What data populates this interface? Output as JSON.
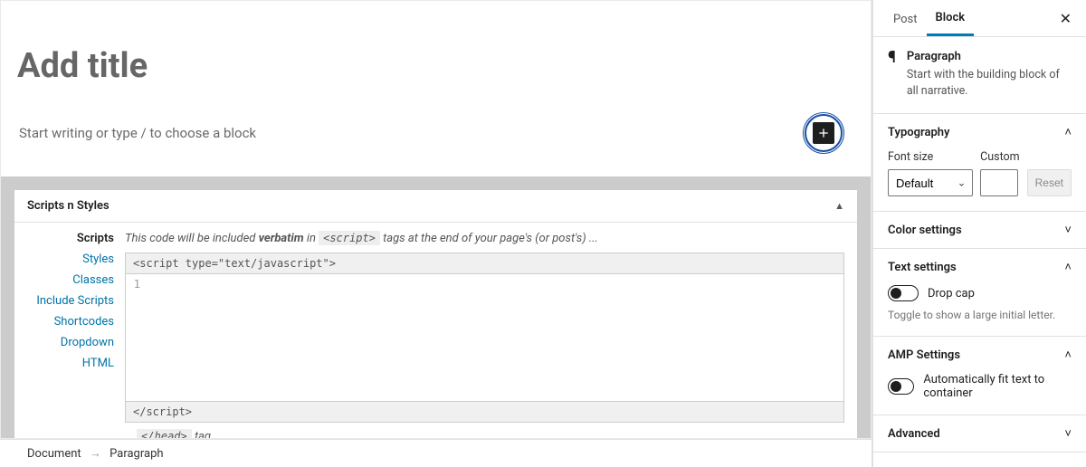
{
  "editor": {
    "title_placeholder": "Add title",
    "paragraph_placeholder": "Start writing or type / to choose a block"
  },
  "metabox": {
    "title": "Scripts n Styles",
    "nav": {
      "scripts": "Scripts",
      "styles": "Styles",
      "classes": "Classes",
      "include_scripts": "Include Scripts",
      "shortcodes": "Shortcodes",
      "dropdown": "Dropdown",
      "html": "HTML"
    },
    "hint_pre": "This code will be included ",
    "hint_verbatim": "verbatim",
    "hint_in": " in ",
    "hint_tag": "<script>",
    "hint_post": " tags at the end of your page's (or post's) ...",
    "code_open": "<script type=\"text/javascript\">",
    "code_close": "</script>",
    "line1": "1",
    "tail_tag": "</head>",
    "tail_text": " tag."
  },
  "breadcrumb": {
    "doc": "Document",
    "para": "Paragraph"
  },
  "sidebar": {
    "tabs": {
      "post": "Post",
      "block": "Block"
    },
    "block_info": {
      "name": "Paragraph",
      "desc": "Start with the building block of all narrative."
    },
    "typography": {
      "title": "Typography",
      "font_size_label": "Font size",
      "custom_label": "Custom",
      "default_option": "Default",
      "reset": "Reset"
    },
    "color": {
      "title": "Color settings"
    },
    "text": {
      "title": "Text settings",
      "drop_cap": "Drop cap",
      "help": "Toggle to show a large initial letter."
    },
    "amp": {
      "title": "AMP Settings",
      "fit": "Automatically fit text to container"
    },
    "advanced": {
      "title": "Advanced"
    }
  }
}
